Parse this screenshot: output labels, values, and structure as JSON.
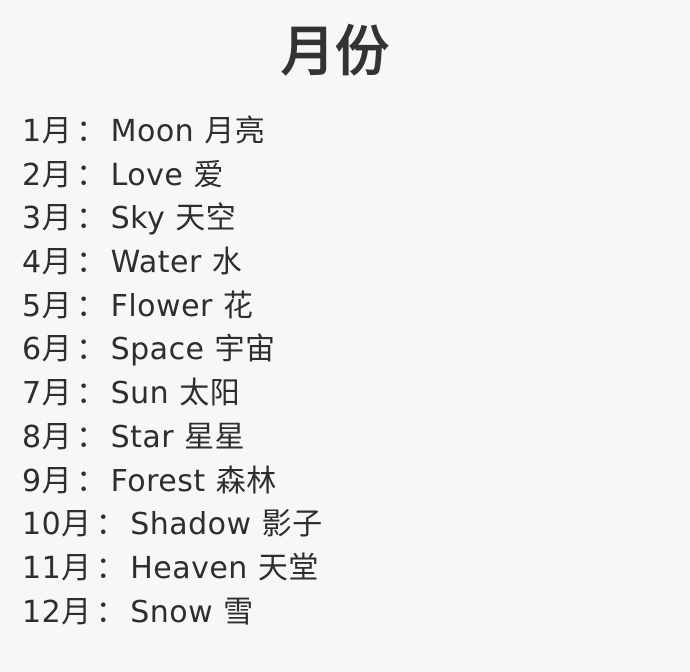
{
  "title": "月份",
  "months": [
    {
      "month": "1月",
      "sep": "：",
      "word": "Moon 月亮"
    },
    {
      "month": "2月",
      "sep": "：",
      "word": "Love 爱"
    },
    {
      "month": "3月",
      "sep": "：",
      "word": "Sky 天空"
    },
    {
      "month": "4月",
      "sep": "：",
      "word": "Water 水"
    },
    {
      "month": "5月",
      "sep": "：",
      "word": "Flower 花"
    },
    {
      "month": "6月",
      "sep": "：",
      "word": "Space 宇宙"
    },
    {
      "month": "7月",
      "sep": "：",
      "word": "Sun 太阳"
    },
    {
      "month": "8月",
      "sep": "：",
      "word": "Star 星星"
    },
    {
      "month": "9月",
      "sep": "：",
      "word": "Forest 森林"
    },
    {
      "month": "10月",
      "sep": "：",
      "word": "Shadow 影子"
    },
    {
      "month": "11月",
      "sep": "：",
      "word": "Heaven 天堂"
    },
    {
      "month": "12月",
      "sep": "：",
      "word": "Snow 雪"
    }
  ]
}
